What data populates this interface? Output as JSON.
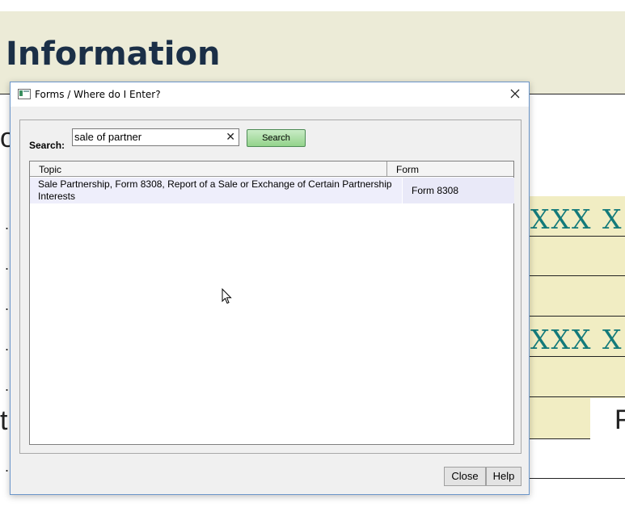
{
  "background": {
    "heading": "Information",
    "fragment_left_1": "o",
    "fragment_left_2": "t",
    "fragment_right": "F",
    "masked_value": "XXX X",
    "dot": "."
  },
  "dialog": {
    "title": "Forms / Where do I Enter?",
    "search_label": "Search:",
    "search_value": "sale of partner",
    "search_button": "Search",
    "columns": {
      "topic": "Topic",
      "form": "Form"
    },
    "rows": [
      {
        "topic": "Sale Partnership, Form 8308, Report of a Sale or Exchange of Certain Partnership Interests",
        "form": "Form 8308"
      }
    ],
    "close_button": "Close",
    "help_button": "Help"
  },
  "colors": {
    "accent_green": "#93d38b",
    "teal_text": "#137a7a",
    "heading": "#1b2f47"
  }
}
